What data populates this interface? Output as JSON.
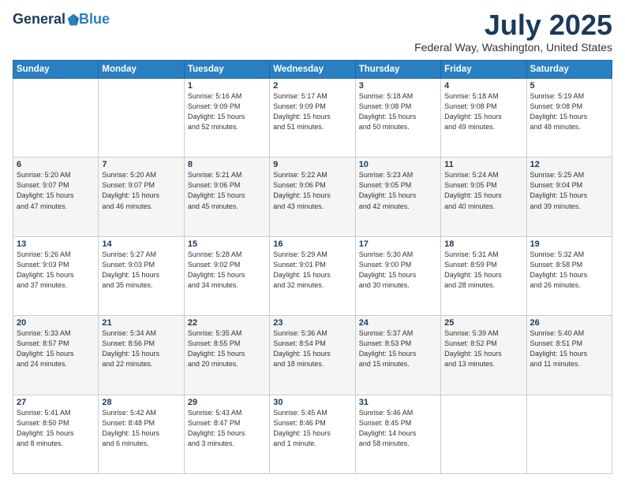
{
  "header": {
    "logo": {
      "general": "General",
      "blue": "Blue"
    },
    "title": "July 2025",
    "location": "Federal Way, Washington, United States"
  },
  "weekdays": [
    "Sunday",
    "Monday",
    "Tuesday",
    "Wednesday",
    "Thursday",
    "Friday",
    "Saturday"
  ],
  "weeks": [
    [
      {
        "day": "",
        "info": ""
      },
      {
        "day": "",
        "info": ""
      },
      {
        "day": "1",
        "info": "Sunrise: 5:16 AM\nSunset: 9:09 PM\nDaylight: 15 hours\nand 52 minutes."
      },
      {
        "day": "2",
        "info": "Sunrise: 5:17 AM\nSunset: 9:09 PM\nDaylight: 15 hours\nand 51 minutes."
      },
      {
        "day": "3",
        "info": "Sunrise: 5:18 AM\nSunset: 9:08 PM\nDaylight: 15 hours\nand 50 minutes."
      },
      {
        "day": "4",
        "info": "Sunrise: 5:18 AM\nSunset: 9:08 PM\nDaylight: 15 hours\nand 49 minutes."
      },
      {
        "day": "5",
        "info": "Sunrise: 5:19 AM\nSunset: 9:08 PM\nDaylight: 15 hours\nand 48 minutes."
      }
    ],
    [
      {
        "day": "6",
        "info": "Sunrise: 5:20 AM\nSunset: 9:07 PM\nDaylight: 15 hours\nand 47 minutes."
      },
      {
        "day": "7",
        "info": "Sunrise: 5:20 AM\nSunset: 9:07 PM\nDaylight: 15 hours\nand 46 minutes."
      },
      {
        "day": "8",
        "info": "Sunrise: 5:21 AM\nSunset: 9:06 PM\nDaylight: 15 hours\nand 45 minutes."
      },
      {
        "day": "9",
        "info": "Sunrise: 5:22 AM\nSunset: 9:06 PM\nDaylight: 15 hours\nand 43 minutes."
      },
      {
        "day": "10",
        "info": "Sunrise: 5:23 AM\nSunset: 9:05 PM\nDaylight: 15 hours\nand 42 minutes."
      },
      {
        "day": "11",
        "info": "Sunrise: 5:24 AM\nSunset: 9:05 PM\nDaylight: 15 hours\nand 40 minutes."
      },
      {
        "day": "12",
        "info": "Sunrise: 5:25 AM\nSunset: 9:04 PM\nDaylight: 15 hours\nand 39 minutes."
      }
    ],
    [
      {
        "day": "13",
        "info": "Sunrise: 5:26 AM\nSunset: 9:03 PM\nDaylight: 15 hours\nand 37 minutes."
      },
      {
        "day": "14",
        "info": "Sunrise: 5:27 AM\nSunset: 9:03 PM\nDaylight: 15 hours\nand 35 minutes."
      },
      {
        "day": "15",
        "info": "Sunrise: 5:28 AM\nSunset: 9:02 PM\nDaylight: 15 hours\nand 34 minutes."
      },
      {
        "day": "16",
        "info": "Sunrise: 5:29 AM\nSunset: 9:01 PM\nDaylight: 15 hours\nand 32 minutes."
      },
      {
        "day": "17",
        "info": "Sunrise: 5:30 AM\nSunset: 9:00 PM\nDaylight: 15 hours\nand 30 minutes."
      },
      {
        "day": "18",
        "info": "Sunrise: 5:31 AM\nSunset: 8:59 PM\nDaylight: 15 hours\nand 28 minutes."
      },
      {
        "day": "19",
        "info": "Sunrise: 5:32 AM\nSunset: 8:58 PM\nDaylight: 15 hours\nand 26 minutes."
      }
    ],
    [
      {
        "day": "20",
        "info": "Sunrise: 5:33 AM\nSunset: 8:57 PM\nDaylight: 15 hours\nand 24 minutes."
      },
      {
        "day": "21",
        "info": "Sunrise: 5:34 AM\nSunset: 8:56 PM\nDaylight: 15 hours\nand 22 minutes."
      },
      {
        "day": "22",
        "info": "Sunrise: 5:35 AM\nSunset: 8:55 PM\nDaylight: 15 hours\nand 20 minutes."
      },
      {
        "day": "23",
        "info": "Sunrise: 5:36 AM\nSunset: 8:54 PM\nDaylight: 15 hours\nand 18 minutes."
      },
      {
        "day": "24",
        "info": "Sunrise: 5:37 AM\nSunset: 8:53 PM\nDaylight: 15 hours\nand 15 minutes."
      },
      {
        "day": "25",
        "info": "Sunrise: 5:39 AM\nSunset: 8:52 PM\nDaylight: 15 hours\nand 13 minutes."
      },
      {
        "day": "26",
        "info": "Sunrise: 5:40 AM\nSunset: 8:51 PM\nDaylight: 15 hours\nand 11 minutes."
      }
    ],
    [
      {
        "day": "27",
        "info": "Sunrise: 5:41 AM\nSunset: 8:50 PM\nDaylight: 15 hours\nand 8 minutes."
      },
      {
        "day": "28",
        "info": "Sunrise: 5:42 AM\nSunset: 8:48 PM\nDaylight: 15 hours\nand 6 minutes."
      },
      {
        "day": "29",
        "info": "Sunrise: 5:43 AM\nSunset: 8:47 PM\nDaylight: 15 hours\nand 3 minutes."
      },
      {
        "day": "30",
        "info": "Sunrise: 5:45 AM\nSunset: 8:46 PM\nDaylight: 15 hours\nand 1 minute."
      },
      {
        "day": "31",
        "info": "Sunrise: 5:46 AM\nSunset: 8:45 PM\nDaylight: 14 hours\nand 58 minutes."
      },
      {
        "day": "",
        "info": ""
      },
      {
        "day": "",
        "info": ""
      }
    ]
  ]
}
